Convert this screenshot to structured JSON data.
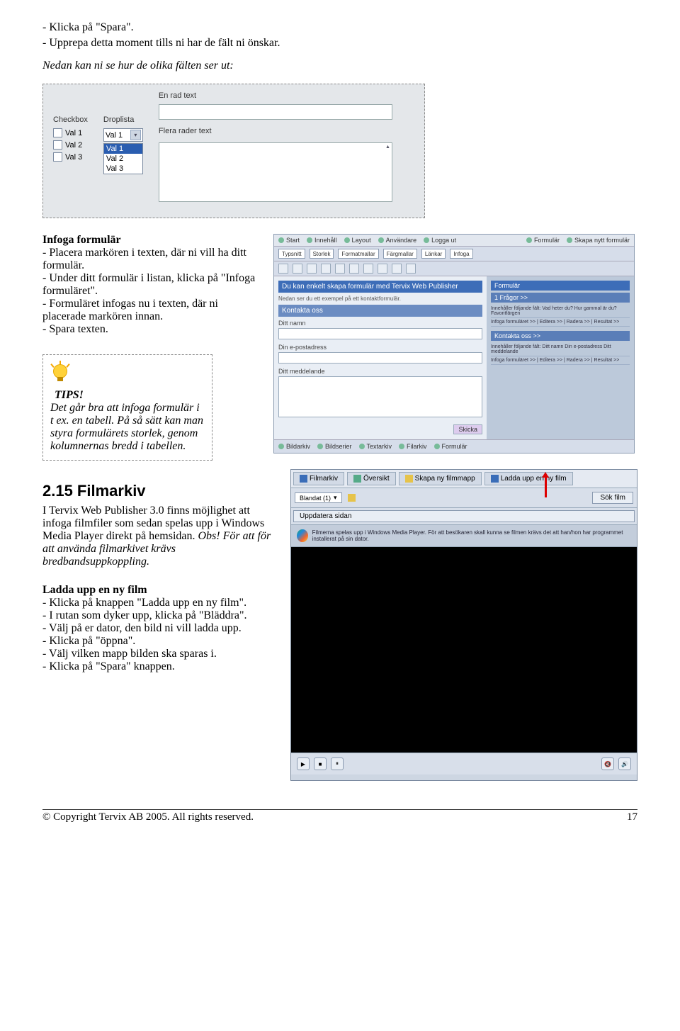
{
  "intro": {
    "line1": "- Klicka på \"Spara\".",
    "line2": "- Upprepa detta moment tills ni har de fält ni önskar.",
    "line3": "Nedan kan ni se hur de olika fälten ser ut:"
  },
  "form_example": {
    "en_rad": "En rad text",
    "flera_rader": "Flera rader text",
    "checkbox_label": "Checkbox",
    "droplista_label": "Droplista",
    "val1": "Val 1",
    "val2": "Val 2",
    "val3": "Val 3",
    "val1s": "Val 1",
    "dl_val1": "Val 1",
    "dl_val2": "Val 2",
    "dl_val3": "Val 3"
  },
  "infoga": {
    "heading": "Infoga formulär",
    "l1": "- Placera markören i texten, där ni vill ha ditt formulär.",
    "l2": "- Under ditt formulär i listan, klicka på \"Infoga formuläret\".",
    "l3": "- Formuläret infogas nu i texten, där ni placerade markören innan.",
    "l4": "- Spara texten."
  },
  "tips": {
    "title": "TIPS!",
    "body": "Det går bra att infoga formulär i t ex. en tabell. På så sätt kan man styra formulärets storlek, genom kolumnernas bredd i tabellen."
  },
  "publisher": {
    "tabs": [
      "Start",
      "Innehåll",
      "Layout",
      "Användare",
      "Logga ut",
      "Formulär",
      "Skapa nytt formulär"
    ],
    "toolbar_items": [
      "Typsnitt",
      "Storlek",
      "Formatmallar",
      "Färgmallar",
      "Länkar",
      "Infoga"
    ],
    "blue1": "Du kan enkelt skapa formulär med Tervix Web Publisher",
    "desc": "Nedan ser du ett exempel på ett kontaktformulär.",
    "kontakta": "Kontakta oss",
    "f_namn": "Ditt namn",
    "f_epost": "Din e-postadress",
    "f_medd": "Ditt meddelande",
    "skicka": "Skicka",
    "r_head1": "Formulär",
    "r_sub1": "1 Frågor >>",
    "r_line1": "Innehåller följande fält: Vad heter du?   Hur gammal är du?   Favoritfärgen",
    "r_line2": "Infoga formuläret >> | Editera >> | Radera >> | Resultat >>",
    "r_sub2": "Kontakta oss >>",
    "r_line3": "Innehåller följande fält: Ditt namn   Din e-postadress   Ditt meddelande",
    "r_line4": "Infoga formuläret >> | Editera >> | Radera >> | Resultat >>",
    "bottom": [
      "Bildarkiv",
      "Bildserier",
      "Textarkiv",
      "Filarkiv",
      "Formulär"
    ]
  },
  "filmarkiv": {
    "heading": "2.15   Filmarkiv",
    "p1": "I Tervix Web Publisher 3.0 finns möjlighet att infoga filmfiler som sedan spelas upp i Windows Media Player direkt på hemsidan. ",
    "p1b": "Obs! För att för att använda filmarkivet krävs bredbandsuppkoppling.",
    "ladda_head": "Ladda upp en ny film",
    "l1": "- Klicka på knappen \"Ladda upp en ny film\".",
    "l2": "- I rutan som dyker upp, klicka på \"Bläddra\".",
    "l3": "- Välj på er dator, den bild ni vill ladda upp.",
    "l4": "- Klicka på \"öppna\".",
    "l5": "- Välj vilken mapp bilden ska sparas i.",
    "l6": "- Klicka på \"Spara\" knappen.",
    "tabs": [
      "Filmarkiv",
      "Översikt",
      "Skapa ny filmmapp",
      "Ladda upp en ny film"
    ],
    "blandat": "Blandat (1)",
    "sok": "Sök film",
    "uppdatera": "Uppdatera sidan",
    "msg": "Filmerna spelas upp i Windows Media Player. För att besökaren skall kunna se filmen krävs det att han/hon har programmet installerat på sin dator."
  },
  "footer": {
    "copyright": "© Copyright Tervix AB 2005. All rights reserved.",
    "page": "17"
  }
}
